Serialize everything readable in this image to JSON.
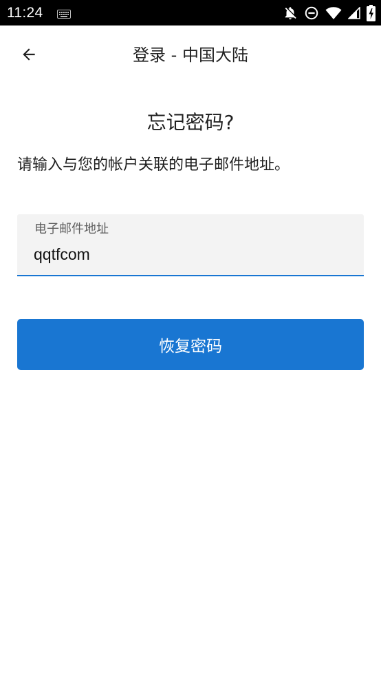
{
  "status_bar": {
    "time": "11:24",
    "icons": [
      "keyboard-icon",
      "notifications-off-icon",
      "do-not-disturb-icon",
      "wifi-icon",
      "cell-signal-icon",
      "battery-charging-icon"
    ]
  },
  "app_bar": {
    "back_icon": "arrow-back-icon",
    "title": "登录 - 中国大陆"
  },
  "main": {
    "heading": "忘记密码?",
    "instruction": "请输入与您的帐户关联的电子邮件地址。",
    "email_field": {
      "label": "电子邮件地址",
      "value": "qqtfcom"
    },
    "recover_button": "恢复密码"
  },
  "colors": {
    "accent": "#1976d2",
    "field_bg": "#f3f3f3",
    "status_bar_bg": "#000000"
  }
}
